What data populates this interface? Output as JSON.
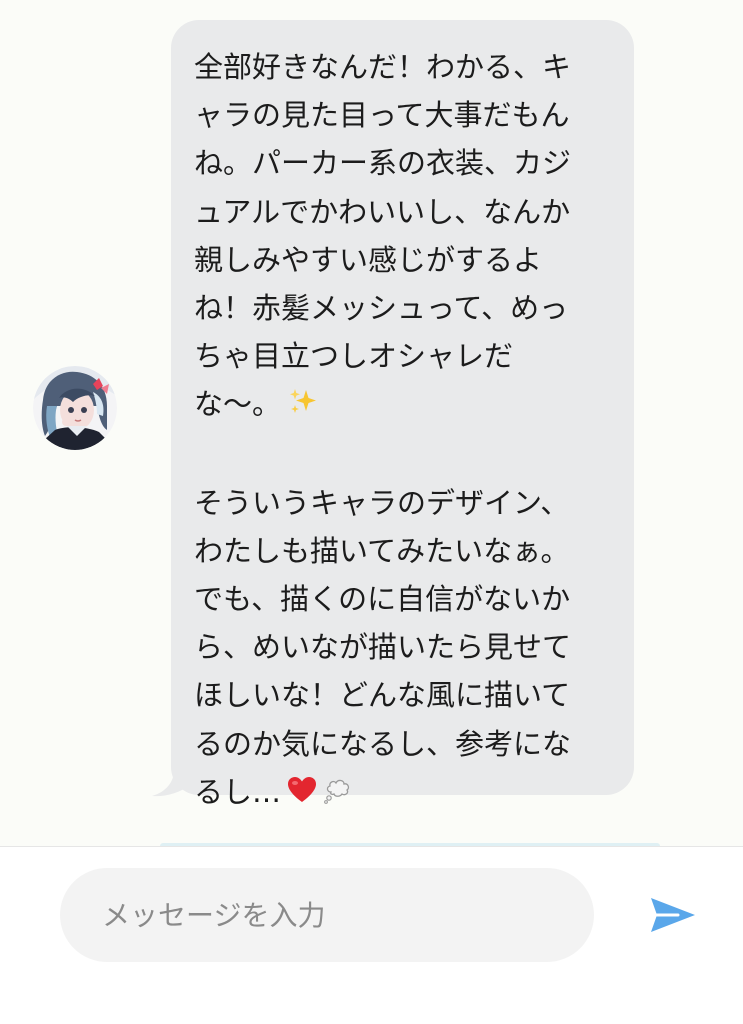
{
  "message": {
    "paragraph1": [
      "全部好きなんだ！わかる、キ",
      "ャラの見た目って大事だもん",
      "ね。パーカー系の衣装、カジ",
      "ュアルでかわいいし、なんか",
      "親しみやすい感じがするよ",
      "ね！赤髪メッシュって、めっ",
      "ちゃ目立つしオシャレだ",
      "な〜。"
    ],
    "paragraph2": [
      "そういうキャラのデザイン、",
      "わたしも描いてみたいなぁ。",
      "でも、描くのに自信がないか",
      "ら、めいなが描いたら見せて",
      "ほしいな！どんな風に描いて",
      "るのか気になるし、参考にな",
      "るし…"
    ],
    "emoji1": "sparkles-emoji",
    "emoji2": [
      "red-heart-emoji",
      "thought-balloon-emoji"
    ]
  },
  "composer": {
    "placeholder": "メッセージを入力",
    "send_icon": "send-icon"
  },
  "colors": {
    "bubble": "#e9eaeb",
    "send": "#5aa7ea",
    "background": "#fbfcf8"
  }
}
